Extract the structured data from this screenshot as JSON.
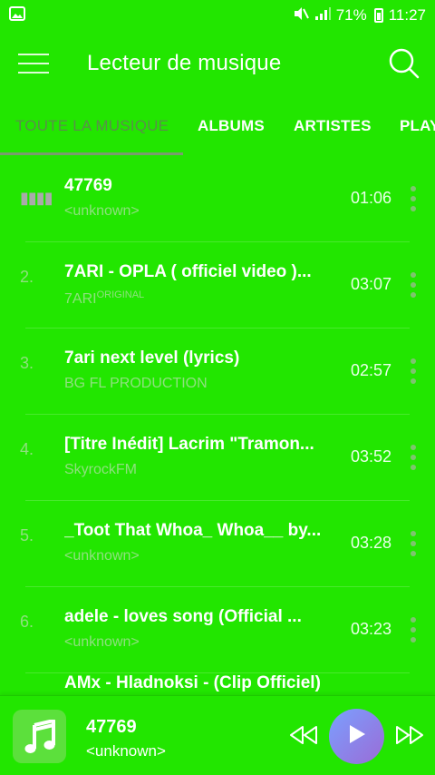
{
  "status_bar": {
    "battery_percent": "71%",
    "time": "11:27"
  },
  "toolbar": {
    "title": "Lecteur de musique"
  },
  "tabs": [
    {
      "label": "TOUTE LA MUSIQUE",
      "active": true
    },
    {
      "label": "ALBUMS",
      "active": false
    },
    {
      "label": "ARTISTES",
      "active": false
    },
    {
      "label": "PLAY",
      "active": false
    }
  ],
  "songs": [
    {
      "number": "",
      "playing": true,
      "title": "47769",
      "artist": "<unknown>",
      "artist_sup": "",
      "duration": "01:06"
    },
    {
      "number": "2.",
      "playing": false,
      "title": "7ARI - OPLA ( officiel video )...",
      "artist": "7ARI",
      "artist_sup": "ORIGINAL",
      "duration": "03:07"
    },
    {
      "number": "3.",
      "playing": false,
      "title": "7ari next level (lyrics)",
      "artist": "BG FL PRODUCTION",
      "artist_sup": "",
      "duration": "02:57"
    },
    {
      "number": "4.",
      "playing": false,
      "title": "[Titre Inédit] Lacrim \"Tramon...",
      "artist": "SkyrockFM",
      "artist_sup": "",
      "duration": "03:52"
    },
    {
      "number": "5.",
      "playing": false,
      "title": "_Toot That Whoa_ Whoa__ by...",
      "artist": "<unknown>",
      "artist_sup": "",
      "duration": "03:28"
    },
    {
      "number": "6.",
      "playing": false,
      "title": "adele - loves song  (Official ...",
      "artist": "<unknown>",
      "artist_sup": "",
      "duration": "03:23"
    }
  ],
  "partial_song": {
    "title": "AMx - Hladnoksi - (Clip Officiel)"
  },
  "now_playing": {
    "title": "47769",
    "artist": "<unknown>"
  },
  "colors": {
    "background": "#22e600",
    "play_button_gradient_start": "#7aa0ff",
    "play_button_gradient_end": "#9b6bd6"
  },
  "icons": {
    "menu": "hamburger-icon",
    "search": "search-icon",
    "row_menu": "more-vert-icon",
    "previous": "rewind-icon",
    "play": "play-icon",
    "next": "fast-forward-icon",
    "album": "music-note-icon"
  }
}
